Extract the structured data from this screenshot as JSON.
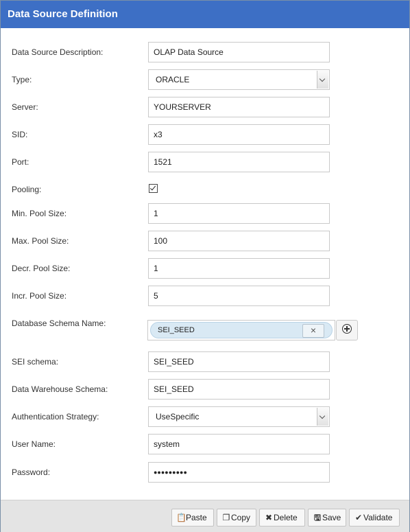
{
  "dialog": {
    "title": "Data Source Definition"
  },
  "form": {
    "description": {
      "label": "Data Source Description:",
      "value": "OLAP Data Source"
    },
    "type": {
      "label": "Type:",
      "value": "ORACLE"
    },
    "server": {
      "label": "Server:",
      "value": "YOURSERVER"
    },
    "sid": {
      "label": "SID:",
      "value": "x3"
    },
    "port": {
      "label": "Port:",
      "value": "1521"
    },
    "pooling": {
      "label": "Pooling:",
      "checked": true
    },
    "min_pool": {
      "label": "Min. Pool Size:",
      "value": "1"
    },
    "max_pool": {
      "label": "Max. Pool Size:",
      "value": "100"
    },
    "decr_pool": {
      "label": "Decr. Pool Size:",
      "value": "1"
    },
    "incr_pool": {
      "label": "Incr. Pool Size:",
      "value": "5"
    },
    "db_schema": {
      "label": "Database Schema Name:",
      "tag": "SEI_SEED",
      "remove_glyph": "×"
    },
    "sei_schema": {
      "label": "SEI schema:",
      "value": "SEI_SEED"
    },
    "dw_schema": {
      "label": "Data Warehouse Schema:",
      "value": "SEI_SEED"
    },
    "auth": {
      "label": "Authentication Strategy:",
      "value": "UseSpecific"
    },
    "user": {
      "label": "User Name:",
      "value": "system"
    },
    "password": {
      "label": "Password:",
      "value": "●●●●●●●●●"
    }
  },
  "buttons": {
    "paste": {
      "label": "Paste",
      "icon": "clipboard-icon"
    },
    "copy": {
      "label": "Copy",
      "icon": "copy-icon"
    },
    "delete": {
      "label": "Delete",
      "icon": "close-icon"
    },
    "save": {
      "label": "Save",
      "icon": "floppy-icon"
    },
    "validate": {
      "label": "Validate",
      "icon": "check-icon"
    }
  }
}
